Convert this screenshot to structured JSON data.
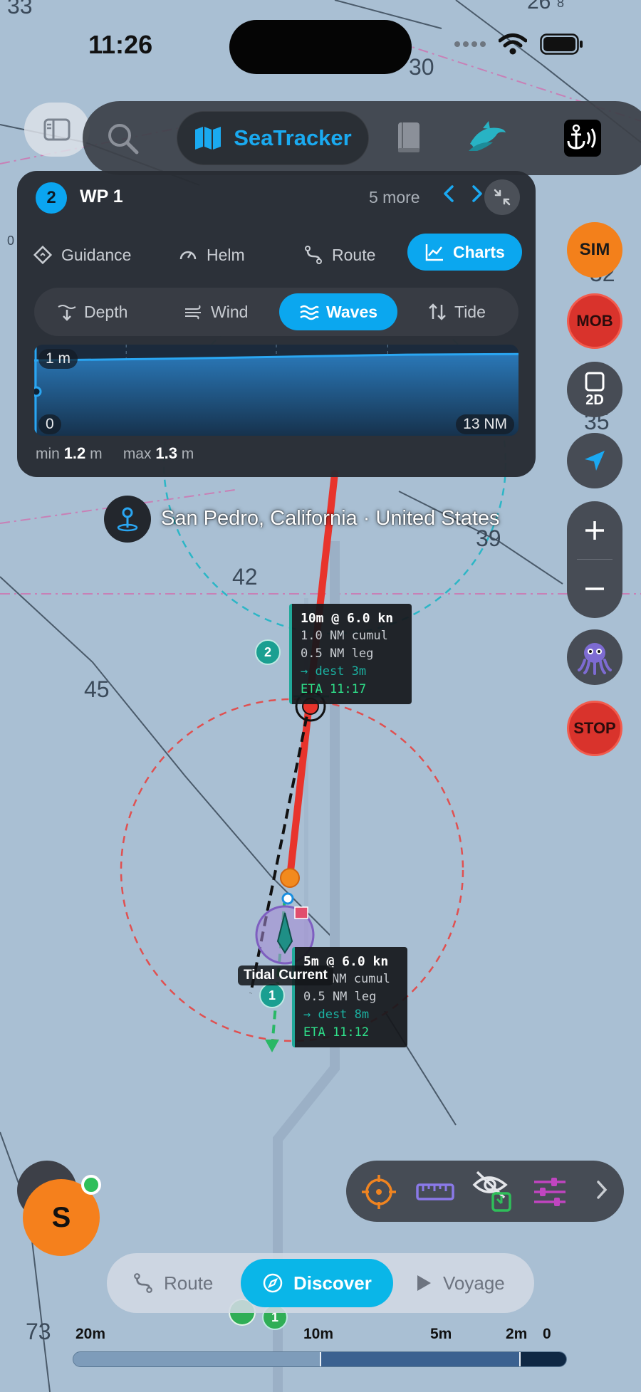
{
  "status_bar": {
    "time": "11:26"
  },
  "toolbar": {
    "brand_label": "SeaTracker"
  },
  "waypoint": {
    "number": "2",
    "name": "WP 1",
    "more_label": "5 more"
  },
  "tabs": [
    {
      "label": "Guidance",
      "icon": "diamond-icon"
    },
    {
      "label": "Helm",
      "icon": "gauge-icon"
    },
    {
      "label": "Route",
      "icon": "route-icon"
    },
    {
      "label": "Charts",
      "icon": "chart-icon",
      "active": true
    }
  ],
  "subtabs": [
    {
      "label": "Depth",
      "icon": "depth-icon"
    },
    {
      "label": "Wind",
      "icon": "wind-icon"
    },
    {
      "label": "Waves",
      "icon": "waves-icon",
      "active": true
    },
    {
      "label": "Tide",
      "icon": "tide-icon"
    }
  ],
  "chart_data": {
    "type": "area",
    "series_label": "Waves",
    "y_axis_label": "1 m",
    "x_start_label": "0",
    "x_end_label": "13 NM",
    "x": [
      0,
      3,
      7,
      10,
      13
    ],
    "values": [
      1.2,
      1.22,
      1.26,
      1.29,
      1.3
    ],
    "xlim": [
      0,
      13
    ],
    "ylim": [
      0,
      1.45
    ],
    "grid": true,
    "color": "#1e90e0"
  },
  "stats": {
    "min_label": "min",
    "min_value": "1.2",
    "max_label": "max",
    "max_value": "1.3",
    "unit": "m"
  },
  "location": {
    "text": "San Pedro, California · United States"
  },
  "controls": {
    "sim": "SIM",
    "mob": "MOB",
    "view_mode": "2D",
    "stop": "STOP"
  },
  "map": {
    "depths": [
      "33",
      "26",
      "8",
      "30",
      "0",
      "32",
      "35",
      "39",
      "42",
      "45",
      "73"
    ],
    "waypoint_callouts": [
      {
        "marker": "2",
        "title": "10m @ 6.0 kn",
        "cumul": "1.0 NM cumul",
        "leg": "0.5 NM leg",
        "dest": "→ dest  3m",
        "eta": "ETA 11:17"
      },
      {
        "marker": "1",
        "title": "5m @ 6.0 kn",
        "cumul": "NM cumul",
        "leg": "0.5 NM leg",
        "dest": "→ dest  8m",
        "eta": "ETA 11:12"
      }
    ],
    "tidal_label": "Tidal Current",
    "bottom_marker": "1"
  },
  "avatar": {
    "initial": "S"
  },
  "modes": [
    {
      "label": "Route",
      "icon": "route-icon"
    },
    {
      "label": "Discover",
      "icon": "compass-icon",
      "active": true
    },
    {
      "label": "Voyage",
      "icon": "play-icon"
    }
  ],
  "scale": {
    "labels": [
      "20m",
      "10m",
      "5m",
      "2m",
      "0"
    ]
  },
  "colors": {
    "accent": "#0ba7ef",
    "route": "#e8342c",
    "sim": "#f3801b"
  }
}
